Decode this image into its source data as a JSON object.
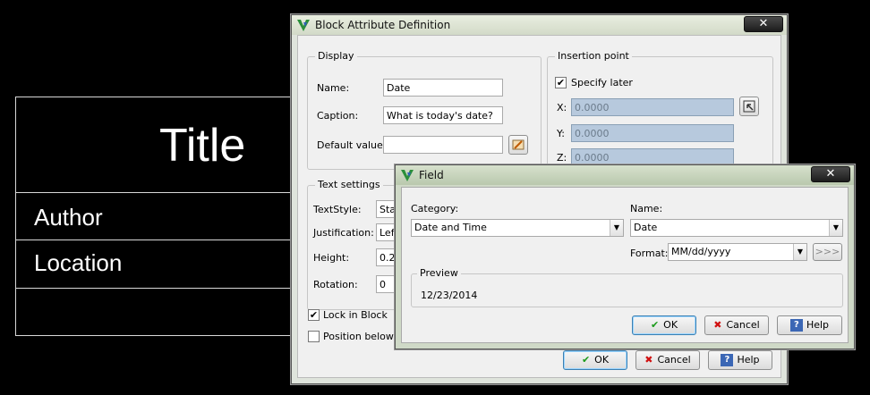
{
  "cad": {
    "title": "Title",
    "author": "Author",
    "location": "Location"
  },
  "block_dialog": {
    "title": "Block Attribute Definition",
    "close": "✕",
    "display": {
      "label": "Display",
      "name_label": "Name:",
      "name_value": "Date",
      "caption_label": "Caption:",
      "caption_value": "What is today's date?",
      "default_label": "Default value:",
      "default_value": ""
    },
    "insertion": {
      "label": "Insertion point",
      "specify_later": "Specify later",
      "specify_later_checked": true,
      "x_label": "X:",
      "x_value": "0.0000",
      "y_label": "Y:",
      "y_value": "0.0000",
      "z_label": "Z:",
      "z_value": "0.0000"
    },
    "text_settings": {
      "label": "Text settings",
      "textstyle_label": "TextStyle:",
      "textstyle_value": "Star",
      "justification_label": "Justification:",
      "justification_value": "Left",
      "height_label": "Height:",
      "height_value": "0.2",
      "rotation_label": "Rotation:",
      "rotation_value": "0"
    },
    "lock_in_block": "Lock in Block",
    "lock_in_block_checked": true,
    "position_below": "Position below la",
    "ok": "OK",
    "cancel": "Cancel",
    "help": "Help"
  },
  "field_dialog": {
    "title": "Field",
    "close": "✕",
    "category_label": "Category:",
    "category_value": "Date and Time",
    "name_label": "Name:",
    "name_value": "Date",
    "format_label": "Format:",
    "format_value": "MM/dd/yyyy",
    "more": ">>>",
    "preview_label": "Preview",
    "preview_value": "12/23/2014",
    "ok": "OK",
    "cancel": "Cancel",
    "help": "Help"
  },
  "colors": {
    "accent": "#3c7fb1",
    "disabled_field": "#b7c9dd",
    "ok_check": "#1a9a1a",
    "cancel_x": "#d01010",
    "help_icon": "#3b67b5"
  },
  "icons": [
    "app-icon",
    "close-icon",
    "pick-point-icon",
    "insert-field-icon",
    "check-icon",
    "cancel-x-icon",
    "help-icon",
    "chevron-down-icon"
  ]
}
